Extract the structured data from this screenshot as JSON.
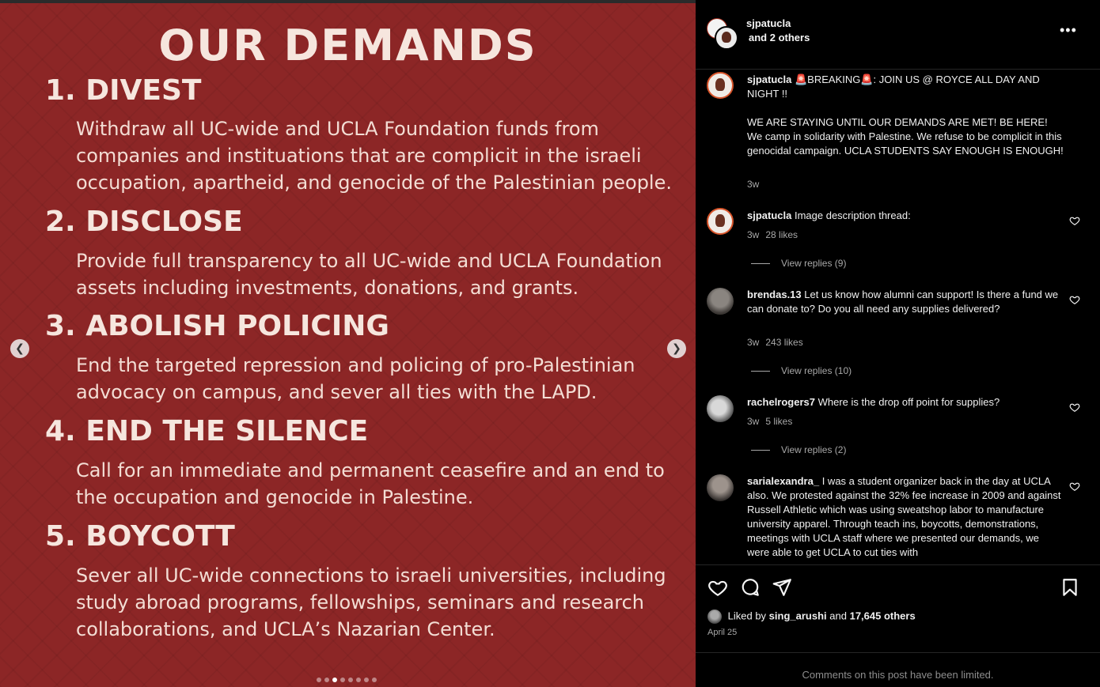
{
  "poster": {
    "title": "OUR DEMANDS",
    "demands": [
      {
        "heading": "1. DIVEST",
        "text": "Withdraw all UC-wide and UCLA Foundation funds from companies and instituations that are complicit in the israeli occupation, apartheid, and genocide of the Palestinian people."
      },
      {
        "heading": "2. DISCLOSE",
        "text": "Provide full transparency to all UC-wide and UCLA Foundation assets including investments, donations, and grants."
      },
      {
        "heading": "3. ABOLISH POLICING",
        "text": "End the targeted repression and policing of pro-Palestinian advocacy on campus, and sever all ties with the LAPD."
      },
      {
        "heading": "4. END THE SILENCE",
        "text": "Call for an immediate and permanent ceasefire and an end to the occupation and genocide in Palestine."
      },
      {
        "heading": "5. BOYCOTT",
        "text": "Sever all UC-wide connections to israeli universities, including study abroad programs, fellowships, seminars and research collaborations, and UCLA’s Nazarian Center."
      }
    ],
    "prev_icon": "chevron-left-icon",
    "next_icon": "chevron-right-icon",
    "carousel_total": 8,
    "carousel_active_index": 2
  },
  "header": {
    "username": "sjpatucla",
    "coauthors": "and 2 others",
    "more_icon": "more-horizontal-icon"
  },
  "caption": {
    "username": "sjpatucla",
    "text_line1": "🚨BREAKING🚨: JOIN US @ ROYCE ALL DAY AND NIGHT !!",
    "text_line2": "WE ARE STAYING UNTIL OUR DEMANDS ARE MET! BE HERE! We camp in solidarity with Palestine. We refuse to be complicit in this genocidal campaign. UCLA STUDENTS SAY ENOUGH IS ENOUGH!",
    "time": "3w"
  },
  "comments": [
    {
      "username": "sjpatucla",
      "text": "Image description thread:",
      "time": "3w",
      "likes": "28 likes",
      "replies": "View replies (9)"
    },
    {
      "username": "brendas.13",
      "text": "Let us know how alumni can support! Is there a fund we can donate to? Do you all need any supplies delivered?",
      "time": "3w",
      "likes": "243 likes",
      "replies": "View replies (10)"
    },
    {
      "username": "rachelrogers7",
      "text": "Where is the drop off point for supplies?",
      "time": "3w",
      "likes": "5 likes",
      "replies": "View replies (2)"
    },
    {
      "username": "sarialexandra_",
      "text": "I was a student organizer back in the day at UCLA also. We protested against the 32% fee increase in 2009 and against Russell Athletic which was using sweatshop labor to manufacture university apparel. Through teach ins, boycotts, demonstrations, meetings with UCLA staff where we presented our demands, we were able to get UCLA to cut ties with"
    }
  ],
  "actions": {
    "like_icon": "heart-icon",
    "comment_icon": "comment-icon",
    "share_icon": "send-icon",
    "save_icon": "bookmark-icon",
    "liked_by_prefix": "Liked by",
    "liked_by_user": "sing_arushi",
    "liked_by_and": "and",
    "liked_by_others": "17,645 others",
    "date": "April 25"
  },
  "footer": {
    "limited_text": "Comments on this post have been limited."
  }
}
